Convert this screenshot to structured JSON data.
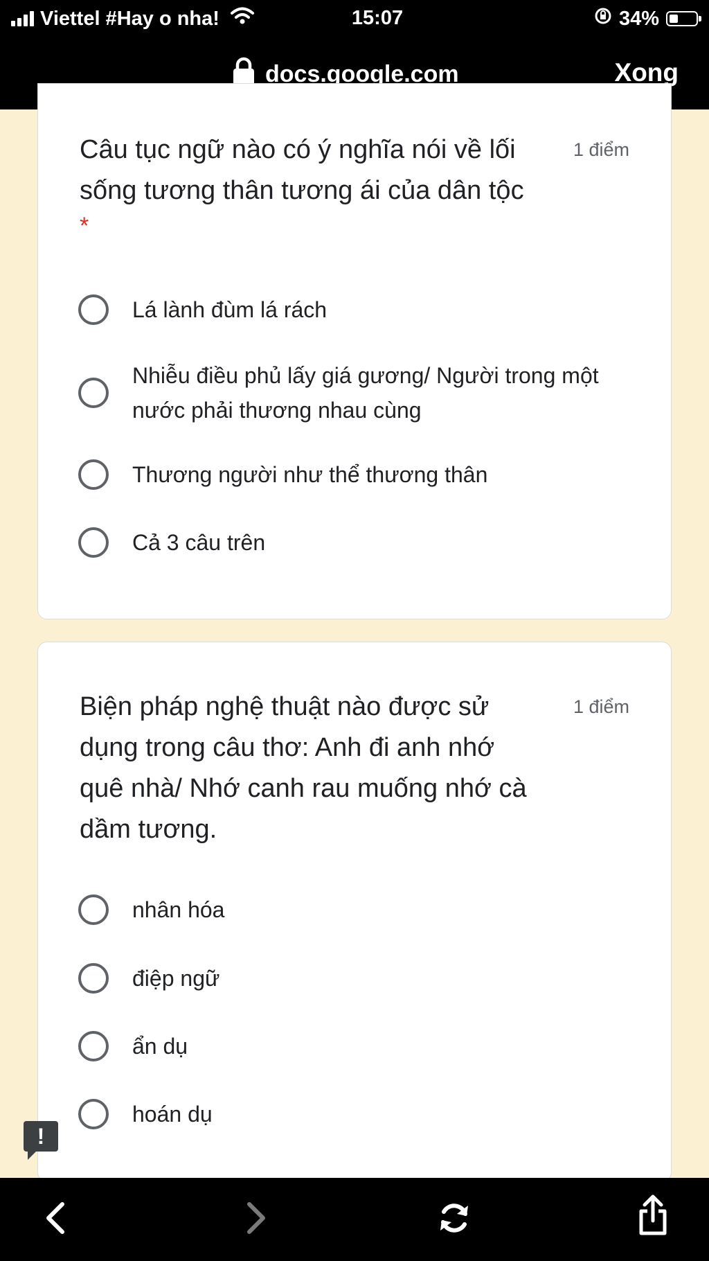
{
  "status_bar": {
    "carrier": "Viettel #Hay o nha!",
    "time": "15:07",
    "battery_percent": "34%",
    "battery_level": 0.34,
    "icons": [
      "signal-icon",
      "wifi-icon",
      "orientation-lock-icon",
      "battery-icon"
    ]
  },
  "browser": {
    "url": "docs.google.com",
    "done_label": "Xong",
    "toolbar_icons": [
      "back-icon",
      "forward-icon",
      "refresh-icon",
      "share-icon"
    ]
  },
  "questions": [
    {
      "title": "Câu tục ngữ nào có ý nghĩa nói về lối sống tương thân tương ái của dân tộc",
      "points": "1 điểm",
      "required_mark": "*",
      "options": [
        "Lá lành đùm lá rách",
        "Nhiễu điều phủ lấy giá gương/ Người trong một nước phải thương nhau cùng",
        "Thương người như thể thương thân",
        "Cả 3 câu trên"
      ]
    },
    {
      "title": "Biện pháp nghệ thuật nào được sử dụng trong câu thơ: Anh đi anh nhớ quê nhà/ Nhớ canh rau muống nhớ cà dầm tương.",
      "points": "1 điểm",
      "options": [
        "nhân hóa",
        "điệp ngữ",
        "ẩn dụ",
        "hoán dụ"
      ]
    }
  ],
  "feedback_label": "!"
}
